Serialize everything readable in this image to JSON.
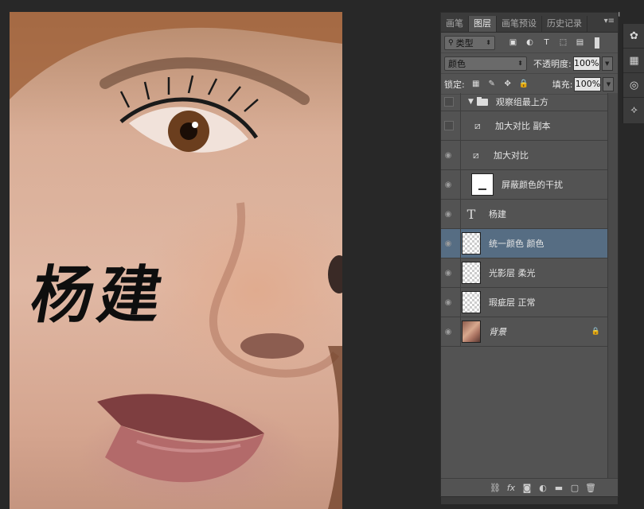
{
  "signature_text": "杨建",
  "panel": {
    "tabs": [
      {
        "label": "画笔",
        "active": false
      },
      {
        "label": "图层",
        "active": true
      },
      {
        "label": "画笔预设",
        "active": false
      },
      {
        "label": "历史记录",
        "active": false
      }
    ],
    "filter": {
      "label": "类型"
    },
    "blend_mode": "颜色",
    "opacity_label": "不透明度:",
    "opacity_value": "100%",
    "lock_label": "锁定:",
    "fill_label": "填充:",
    "fill_value": "100%"
  },
  "layers": [
    {
      "name": "观察组最上方",
      "kind": "group",
      "visible": false
    },
    {
      "name": "加大对比 副本",
      "kind": "adjustment",
      "visible": false
    },
    {
      "name": "加大对比",
      "kind": "adjustment",
      "visible": true
    },
    {
      "name": "屏蔽颜色的干扰",
      "kind": "mask",
      "visible": true
    },
    {
      "name": "杨建",
      "kind": "text",
      "visible": true
    },
    {
      "name": "统一颜色  颜色",
      "kind": "pixel",
      "visible": true,
      "selected": true
    },
    {
      "name": "光影层  柔光",
      "kind": "pixel",
      "visible": true
    },
    {
      "name": "瑕疵层  正常",
      "kind": "pixel",
      "visible": true
    },
    {
      "name": "背景",
      "kind": "background",
      "visible": true,
      "locked": true
    }
  ],
  "colors": {
    "selected_layer": "#566d83",
    "panel_bg": "#535353",
    "workspace_bg": "#282828"
  }
}
